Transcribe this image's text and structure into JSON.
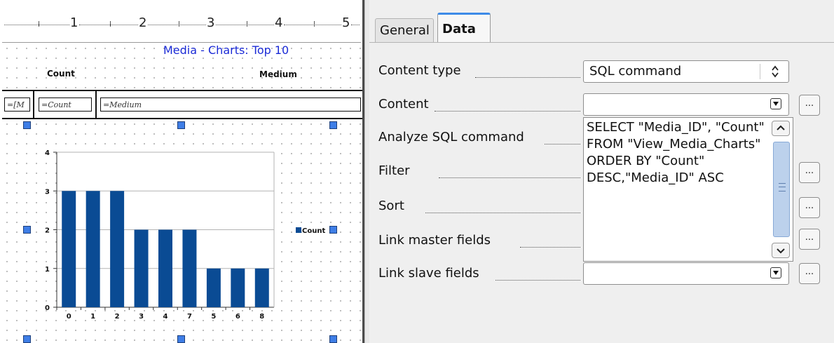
{
  "ruler": {
    "marks": [
      "1",
      "2",
      "3",
      "4",
      "5"
    ]
  },
  "report": {
    "title": "Media - Charts: Top 10",
    "header_count": "Count",
    "header_medium": "Medium",
    "field_media_id": "=[M",
    "field_count": "=Count",
    "field_medium": "=Medium"
  },
  "chart_data": {
    "type": "bar",
    "categories": [
      "0",
      "1",
      "2",
      "3",
      "4",
      "7",
      "5",
      "6",
      "8"
    ],
    "series": [
      {
        "name": "Count",
        "values": [
          3,
          3,
          3,
          2,
          2,
          2,
          1,
          1,
          1
        ],
        "color": "#0a4b94"
      }
    ],
    "y_ticks": [
      "0",
      "1",
      "2",
      "3",
      "4"
    ],
    "ylim": [
      0,
      4
    ],
    "grid": true,
    "legend_position": "right"
  },
  "panel": {
    "tabs": [
      {
        "label": "General",
        "active": false
      },
      {
        "label": "Data",
        "active": true
      }
    ],
    "fields": {
      "content_type": {
        "label": "Content type",
        "value": "SQL command"
      },
      "content": {
        "label": "Content",
        "value": ""
      },
      "analyze_sql": {
        "label": "Analyze SQL command",
        "value": "SELECT \"Media_ID\", \"Count\" FROM \"View_Media_Charts\" ORDER BY \"Count\" DESC,\"Media_ID\" ASC"
      },
      "filter": {
        "label": "Filter",
        "value": ""
      },
      "sort": {
        "label": "Sort",
        "value": ""
      },
      "link_master": {
        "label": "Link master fields",
        "value": ""
      },
      "link_slave": {
        "label": "Link slave fields",
        "value": ""
      }
    },
    "ellipsis_label": "...",
    "accent_color": "#3d8be8"
  }
}
